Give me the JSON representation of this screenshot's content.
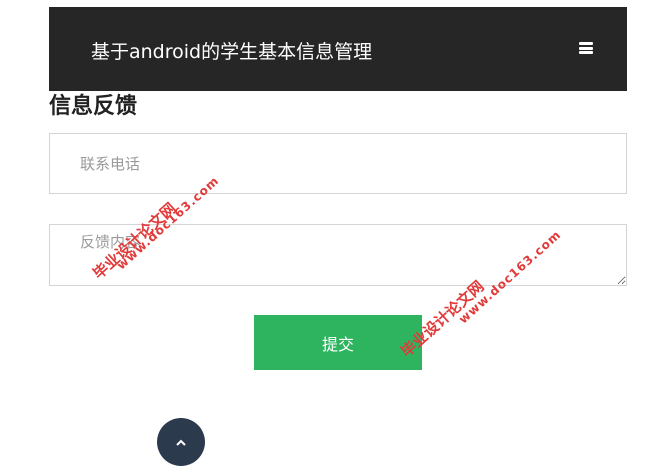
{
  "header": {
    "title": "基于android的学生基本信息管理",
    "menu_icon": "hamburger-menu-icon"
  },
  "form": {
    "section_title": "信息反馈",
    "phone_placeholder": "联系电话",
    "feedback_placeholder": "反馈内容",
    "submit_label": "提交"
  },
  "back_to_top": {
    "icon": "chevron-up-icon"
  },
  "watermark": {
    "site_name": "毕业设计论文网",
    "url": "www.doc163.com"
  },
  "colors": {
    "header_bg": "#262626",
    "submit_bg": "#2eb45f",
    "back_top_bg": "#2b3a4d",
    "watermark": "#e23a3a"
  }
}
